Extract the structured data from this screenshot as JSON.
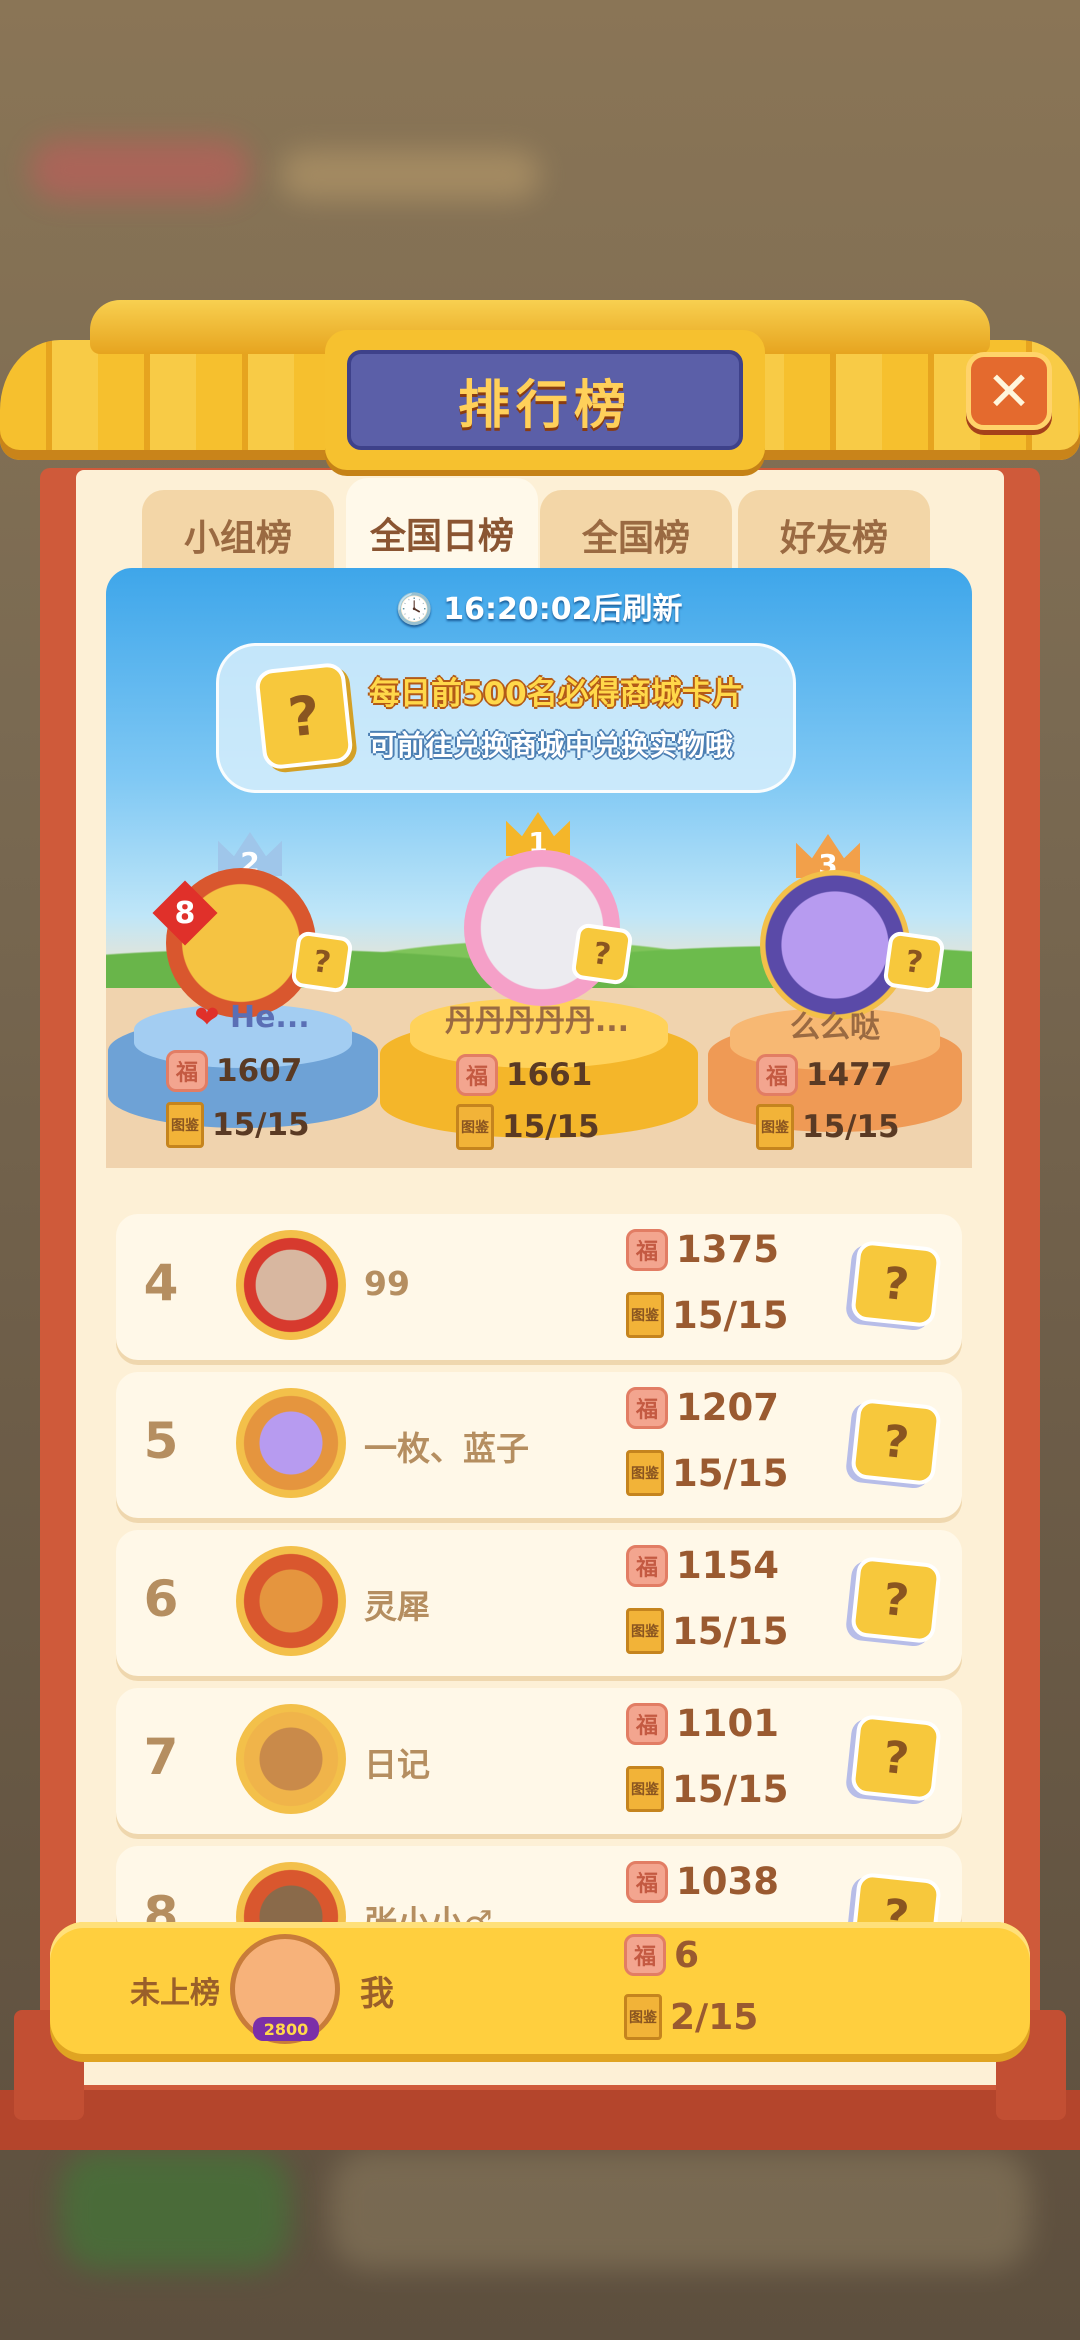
{
  "window": {
    "title": "排行榜",
    "close_label": "✕"
  },
  "tabs": [
    {
      "label": "小组榜",
      "active": false
    },
    {
      "label": "全国日榜",
      "active": true
    },
    {
      "label": "全国榜",
      "active": false
    },
    {
      "label": "好友榜",
      "active": false
    }
  ],
  "timer": {
    "time": "16:20:02",
    "suffix": "后刷新"
  },
  "banner": {
    "line1": "每日前500名必得商城卡片",
    "line2": "可前往兑换商城中兑换实物哦",
    "card_mark": "?"
  },
  "podium": {
    "first": {
      "rank": "1",
      "name": "丹丹丹丹丹...",
      "score": "1661",
      "progress": "15/15"
    },
    "second": {
      "rank": "2",
      "name": "He...",
      "score": "1607",
      "progress": "15/15",
      "avatar_badge": "8"
    },
    "third": {
      "rank": "3",
      "name": "么么哒",
      "score": "1477",
      "progress": "15/15"
    }
  },
  "rows": [
    {
      "rank": "4",
      "name": "99",
      "score": "1375",
      "progress": "15/15"
    },
    {
      "rank": "5",
      "name": "一枚、蓝子",
      "score": "1207",
      "progress": "15/15"
    },
    {
      "rank": "6",
      "name": "灵犀",
      "score": "1154",
      "progress": "15/15"
    },
    {
      "rank": "7",
      "name": "日记",
      "score": "1101",
      "progress": "15/15"
    },
    {
      "rank": "8",
      "name": "张小小♂",
      "score": "1038",
      "progress": ""
    }
  ],
  "me": {
    "rank_label": "未上榜",
    "name": "我",
    "score": "6",
    "progress": "2/15",
    "avatar_badge": "2800"
  },
  "icons": {
    "fu": "福",
    "book": "图鉴",
    "card": "?"
  },
  "colors": {
    "accent": "#f6c12f",
    "frame": "#cf5a3a",
    "title_bg": "#5b5fa8"
  }
}
